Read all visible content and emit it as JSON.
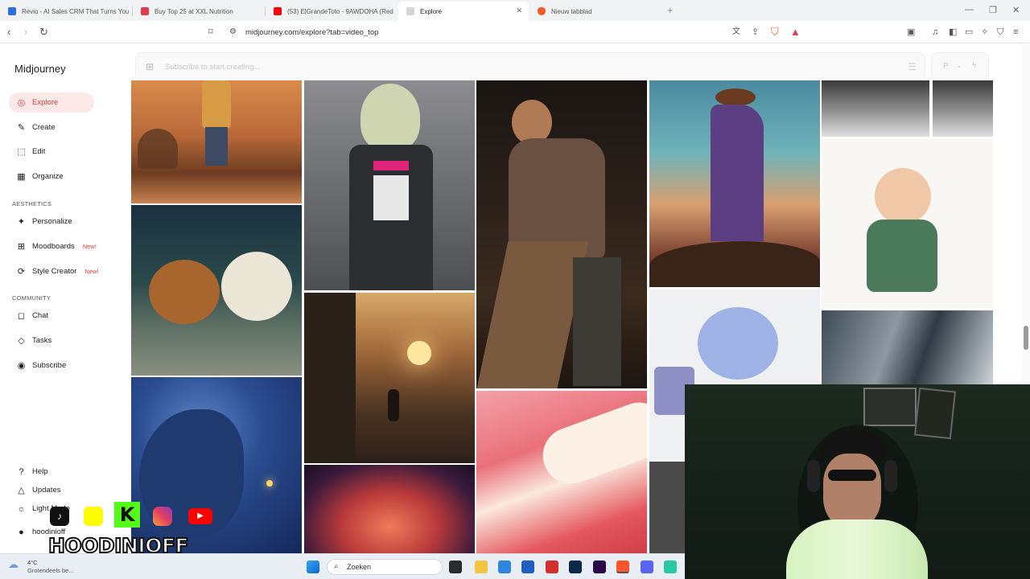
{
  "browser": {
    "tabs": [
      {
        "title": "Revio - AI Sales CRM That Turns You",
        "color": "#2f6fde"
      },
      {
        "title": "Buy Top 25 at XXL Nutrition",
        "color": "#e23b4a"
      },
      {
        "title": "(53) ElGrandeToto - 9AWDOHA (Red",
        "color": "#ff0000"
      },
      {
        "title": "Explore",
        "color": "#555555"
      },
      {
        "title": "Nieuw tabblad",
        "color": "#f15a29"
      }
    ],
    "url": "midjourney.com/explore?tab=video_top"
  },
  "sidebar": {
    "logo": "Midjourney",
    "main_items": [
      {
        "label": "Explore",
        "icon": "compass-icon",
        "glyph": "◎"
      },
      {
        "label": "Create",
        "icon": "brush-icon",
        "glyph": "✎"
      },
      {
        "label": "Edit",
        "icon": "edit-icon",
        "glyph": "⬚"
      },
      {
        "label": "Organize",
        "icon": "grid-icon",
        "glyph": "▦"
      }
    ],
    "aesthetics_label": "AESTHETICS",
    "aesthetics_items": [
      {
        "label": "Personalize",
        "icon": "palette-icon",
        "glyph": "✦",
        "badge": ""
      },
      {
        "label": "Moodboards",
        "icon": "moodboard-icon",
        "glyph": "⊞",
        "badge": "New!"
      },
      {
        "label": "Style Creator",
        "icon": "style-icon",
        "glyph": "⟳",
        "badge": "New!"
      }
    ],
    "community_label": "COMMUNITY",
    "community_items": [
      {
        "label": "Chat",
        "icon": "chat-icon",
        "glyph": "◻"
      },
      {
        "label": "Tasks",
        "icon": "tasks-icon",
        "glyph": "◇"
      },
      {
        "label": "Subscribe",
        "icon": "subscribe-icon",
        "glyph": "◉"
      }
    ],
    "bottom_items": [
      {
        "label": "Help",
        "icon": "help-icon",
        "glyph": "?"
      },
      {
        "label": "Updates",
        "icon": "bell-icon",
        "glyph": "△"
      },
      {
        "label": "Light Mode",
        "icon": "sun-icon",
        "glyph": "☼"
      },
      {
        "label": "hoodinioff",
        "icon": "avatar-icon",
        "glyph": "●"
      }
    ]
  },
  "search": {
    "placeholder": "Subscribe to start creating..."
  },
  "overlay": {
    "channel_name": "HOODINIOFF"
  },
  "taskbar": {
    "temperature": "4°C",
    "weather": "Grotendeels be...",
    "search_label": "Zoeken"
  }
}
